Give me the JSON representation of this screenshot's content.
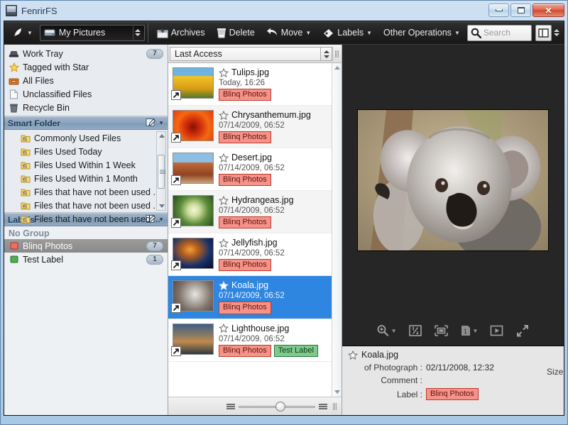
{
  "window": {
    "title": "FenrirFS",
    "icon": "computer-icon",
    "buttons": {
      "minimize": "minimize",
      "maximize": "maximize",
      "close": "✕"
    }
  },
  "toolbar": {
    "quill_menu": "quill-icon",
    "drive": {
      "label": "My Pictures",
      "icon": "drive-icon"
    },
    "items": [
      {
        "id": "archives",
        "label": "Archives",
        "icon": "archive-box-icon",
        "caret": false
      },
      {
        "id": "delete",
        "label": "Delete",
        "icon": "trash-icon",
        "caret": false
      },
      {
        "id": "move",
        "label": "Move",
        "icon": "undo-arrow-icon",
        "caret": true
      },
      {
        "id": "labels",
        "label": "Labels",
        "icon": "tag-icon",
        "caret": true
      },
      {
        "id": "other",
        "label": "Other Operations",
        "icon": "",
        "caret": true
      }
    ],
    "search": {
      "placeholder": "Search",
      "icon": "search-icon"
    },
    "view_toggle": "split-view-icon"
  },
  "sidebar": {
    "places": [
      {
        "label": "Work Tray",
        "icon": "tray-icon",
        "badge": "7"
      },
      {
        "label": "Tagged with Star",
        "icon": "star-icon",
        "badge": ""
      },
      {
        "label": "All Files",
        "icon": "file-box-icon",
        "badge": ""
      },
      {
        "label": "Unclassified Files",
        "icon": "page-icon",
        "badge": ""
      },
      {
        "label": "Recycle Bin",
        "icon": "recycle-bin-icon",
        "badge": ""
      }
    ],
    "smart_folder": {
      "title": "Smart Folder",
      "edit_icon": "edit-icon",
      "items": [
        {
          "label": "Commonly Used Files",
          "icon": "smart-folder-icon"
        },
        {
          "label": "Files Used Today",
          "icon": "smart-folder-icon"
        },
        {
          "label": "Files Used Within 1 Week",
          "icon": "smart-folder-icon"
        },
        {
          "label": "Files Used Within 1 Month",
          "icon": "smart-folder-icon"
        },
        {
          "label": "Files that have not been used ...",
          "icon": "smart-folder-icon"
        },
        {
          "label": "Files that have not been used ...",
          "icon": "smart-folder-icon"
        },
        {
          "label": "Files that have not been used ...",
          "icon": "smart-folder-icon"
        }
      ]
    },
    "labels": {
      "title": "Labels",
      "edit_icon": "edit-icon",
      "group_title": "No Group",
      "items": [
        {
          "label": "Blinq Photos",
          "color": "#ef6d62",
          "badge": "7",
          "selected": true
        },
        {
          "label": "Test Label",
          "color": "#4caf50",
          "badge": "1",
          "selected": false
        }
      ]
    }
  },
  "filelist": {
    "sort": {
      "value": "Last Access"
    },
    "files": [
      {
        "name": "Tulips.jpg",
        "date": "Today, 16:26",
        "starred": false,
        "selected": false,
        "thumb": "tulips",
        "tags": [
          {
            "text": "Blinq Photos",
            "kind": "red"
          }
        ]
      },
      {
        "name": "Chrysanthemum.jpg",
        "date": "07/14/2009, 06:52",
        "starred": false,
        "selected": false,
        "thumb": "chrysanthemum",
        "tags": [
          {
            "text": "Blinq Photos",
            "kind": "red"
          }
        ]
      },
      {
        "name": "Desert.jpg",
        "date": "07/14/2009, 06:52",
        "starred": false,
        "selected": false,
        "thumb": "desert",
        "tags": [
          {
            "text": "Blinq Photos",
            "kind": "red"
          }
        ]
      },
      {
        "name": "Hydrangeas.jpg",
        "date": "07/14/2009, 06:52",
        "starred": false,
        "selected": false,
        "thumb": "hydrangeas",
        "tags": [
          {
            "text": "Blinq Photos",
            "kind": "red"
          }
        ]
      },
      {
        "name": "Jellyfish.jpg",
        "date": "07/14/2009, 06:52",
        "starred": false,
        "selected": false,
        "thumb": "jellyfish",
        "tags": [
          {
            "text": "Blinq Photos",
            "kind": "red"
          }
        ]
      },
      {
        "name": "Koala.jpg",
        "date": "07/14/2009, 06:52",
        "starred": true,
        "selected": true,
        "thumb": "koala",
        "tags": [
          {
            "text": "Blinq Photos",
            "kind": "red"
          }
        ]
      },
      {
        "name": "Lighthouse.jpg",
        "date": "07/14/2009, 06:52",
        "starred": false,
        "selected": false,
        "thumb": "lighthouse",
        "tags": [
          {
            "text": "Blinq Photos",
            "kind": "red"
          },
          {
            "text": "Test Label",
            "kind": "green"
          }
        ]
      }
    ]
  },
  "preview": {
    "image": "koala-photo",
    "toolbar": [
      {
        "id": "zoom",
        "icon": "zoom-in-icon",
        "caret": true
      },
      {
        "id": "actual-size",
        "icon": "one-to-one-icon",
        "caret": false
      },
      {
        "id": "fit-window",
        "icon": "fit-window-icon",
        "caret": false
      },
      {
        "id": "page",
        "icon": "page-number-icon",
        "caret": true
      },
      {
        "id": "slideshow",
        "icon": "play-icon",
        "caret": false
      },
      {
        "id": "fullscreen",
        "icon": "fullscreen-icon",
        "caret": false
      }
    ]
  },
  "details": {
    "filename": "Koala.jpg",
    "star_icon": "star-outline-icon",
    "rows": [
      {
        "label": "of Photograph :",
        "value": "02/11/2008, 12:32"
      },
      {
        "label": "Comment :",
        "value": ""
      },
      {
        "label": "Label :",
        "value": "Blinq Photos",
        "tag": "red"
      }
    ],
    "size_label": "Size :"
  },
  "colors": {
    "accent": "#2f86e0",
    "label_red": "#f5938a",
    "label_green": "#7ec98b",
    "title_text": "#16314e"
  }
}
